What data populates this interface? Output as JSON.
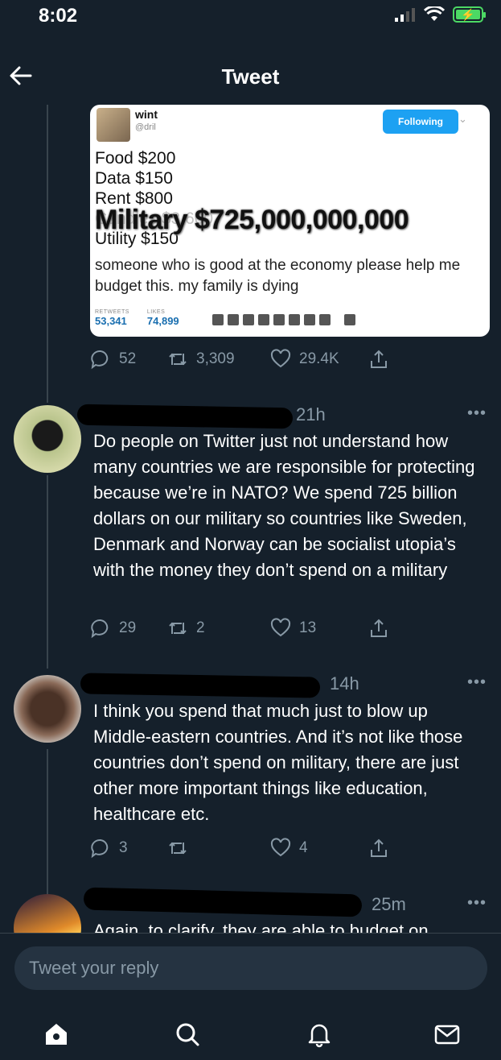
{
  "status": {
    "time": "8:02"
  },
  "header": {
    "title": "Tweet"
  },
  "embed": {
    "name": "wint",
    "handle": "@dril",
    "follow_label": "Following",
    "budget_lines": [
      "Food $200",
      "Data $150",
      "Rent $800",
      "Candles $3,600",
      "Utility $150"
    ],
    "military_line": "Military $725,000,000,000",
    "caption": "someone who is good at the economy please help me budget this. my family is dying",
    "retweets_label": "RETWEETS",
    "retweets": "53,341",
    "likes_label": "LIKES",
    "likes": "74,899"
  },
  "main_actions": {
    "replies": "52",
    "retweets": "3,309",
    "likes": "29.4K"
  },
  "replies": [
    {
      "time": "21h",
      "text": "Do people on Twitter just not understand how many countries we are responsible for protecting because we’re in NATO? We spend 725 billion dollars on our military so countries like Sweden, Denmark and Norway can be socialist utopia’s with the money they don’t spend on a military",
      "replies": "29",
      "retweets": "2",
      "likes": "13"
    },
    {
      "time": "14h",
      "text": "I think you spend that much just to blow up Middle-eastern countries. And it’s not like those countries don’t spend on military, there are just other more important things like education, healthcare etc.",
      "replies": "3",
      "retweets": "",
      "likes": "4"
    },
    {
      "time": "25m",
      "text": "Again, to clarify, they are able to budget on"
    }
  ],
  "reply_box": {
    "placeholder": "Tweet your reply"
  },
  "colors": {
    "background": "#15202b",
    "muted": "#8899a6",
    "accent": "#1da1f2"
  }
}
